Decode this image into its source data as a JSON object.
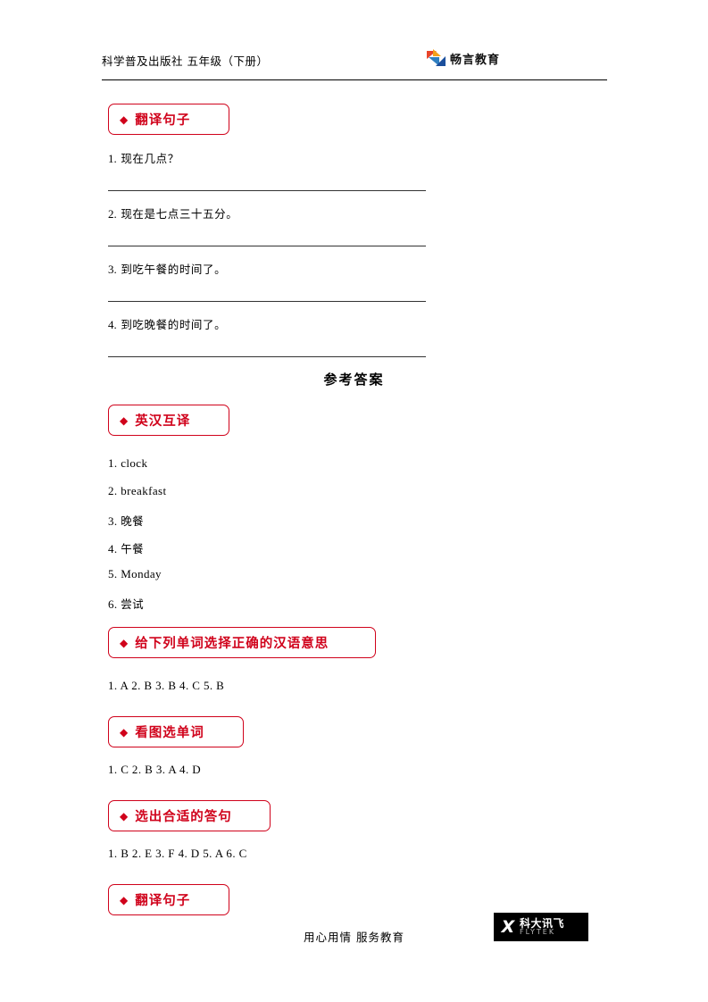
{
  "header": {
    "left_text": "科学普及出版社  五年级（下册）",
    "logo_text": "畅言教育",
    "logo_icon": "colored-triangles-logo"
  },
  "sections": [
    {
      "id": "translate-sentences-top",
      "label": "翻译句子",
      "diamond": "◆"
    },
    {
      "id": "english-chinese-translation",
      "label": "英汉互译",
      "diamond": "◆"
    },
    {
      "id": "choose-correct-meaning",
      "label": "给下列单词选择正确的汉语意思",
      "diamond": "◆"
    },
    {
      "id": "look-and-choose-word",
      "label": "看图选单词",
      "diamond": "◆"
    },
    {
      "id": "choose-proper-response",
      "label": "选出合适的答句",
      "diamond": "◆"
    },
    {
      "id": "translate-sentences-answers",
      "label": "翻译句子",
      "diamond": "◆"
    }
  ],
  "questions": [
    {
      "num": "1.",
      "text": "现在几点？"
    },
    {
      "num": "2.",
      "text": "现在是七点三十五分。"
    },
    {
      "num": "3.",
      "text": "到吃午餐的时间了。"
    },
    {
      "num": "4.",
      "text": "到吃晚餐的时间了。"
    }
  ],
  "answers_heading": "参考答案",
  "answers_en_cn": [
    {
      "num": "1.",
      "text": "clock"
    },
    {
      "num": "2.",
      "text": "breakfast"
    },
    {
      "num": "3.",
      "text": "晚餐"
    },
    {
      "num": "4.",
      "text": "午餐"
    },
    {
      "num": "5.",
      "text": "Monday"
    },
    {
      "num": "6.",
      "text": "尝试"
    }
  ],
  "answers_meaning": "1. A    2. B    3. B    4. C    5. B",
  "answers_picture": "1. C    2. B    3. A    4. D",
  "answers_response": "1. B    2. E    3. F    4. D      5. A      6. C",
  "footer": {
    "text": "用心用情   服务教育",
    "logo_mark": "X",
    "logo_cn": "科大讯飞",
    "logo_en": "FLYTEK"
  },
  "colors": {
    "accent_red": "#d0021b",
    "rule": "#333333"
  }
}
